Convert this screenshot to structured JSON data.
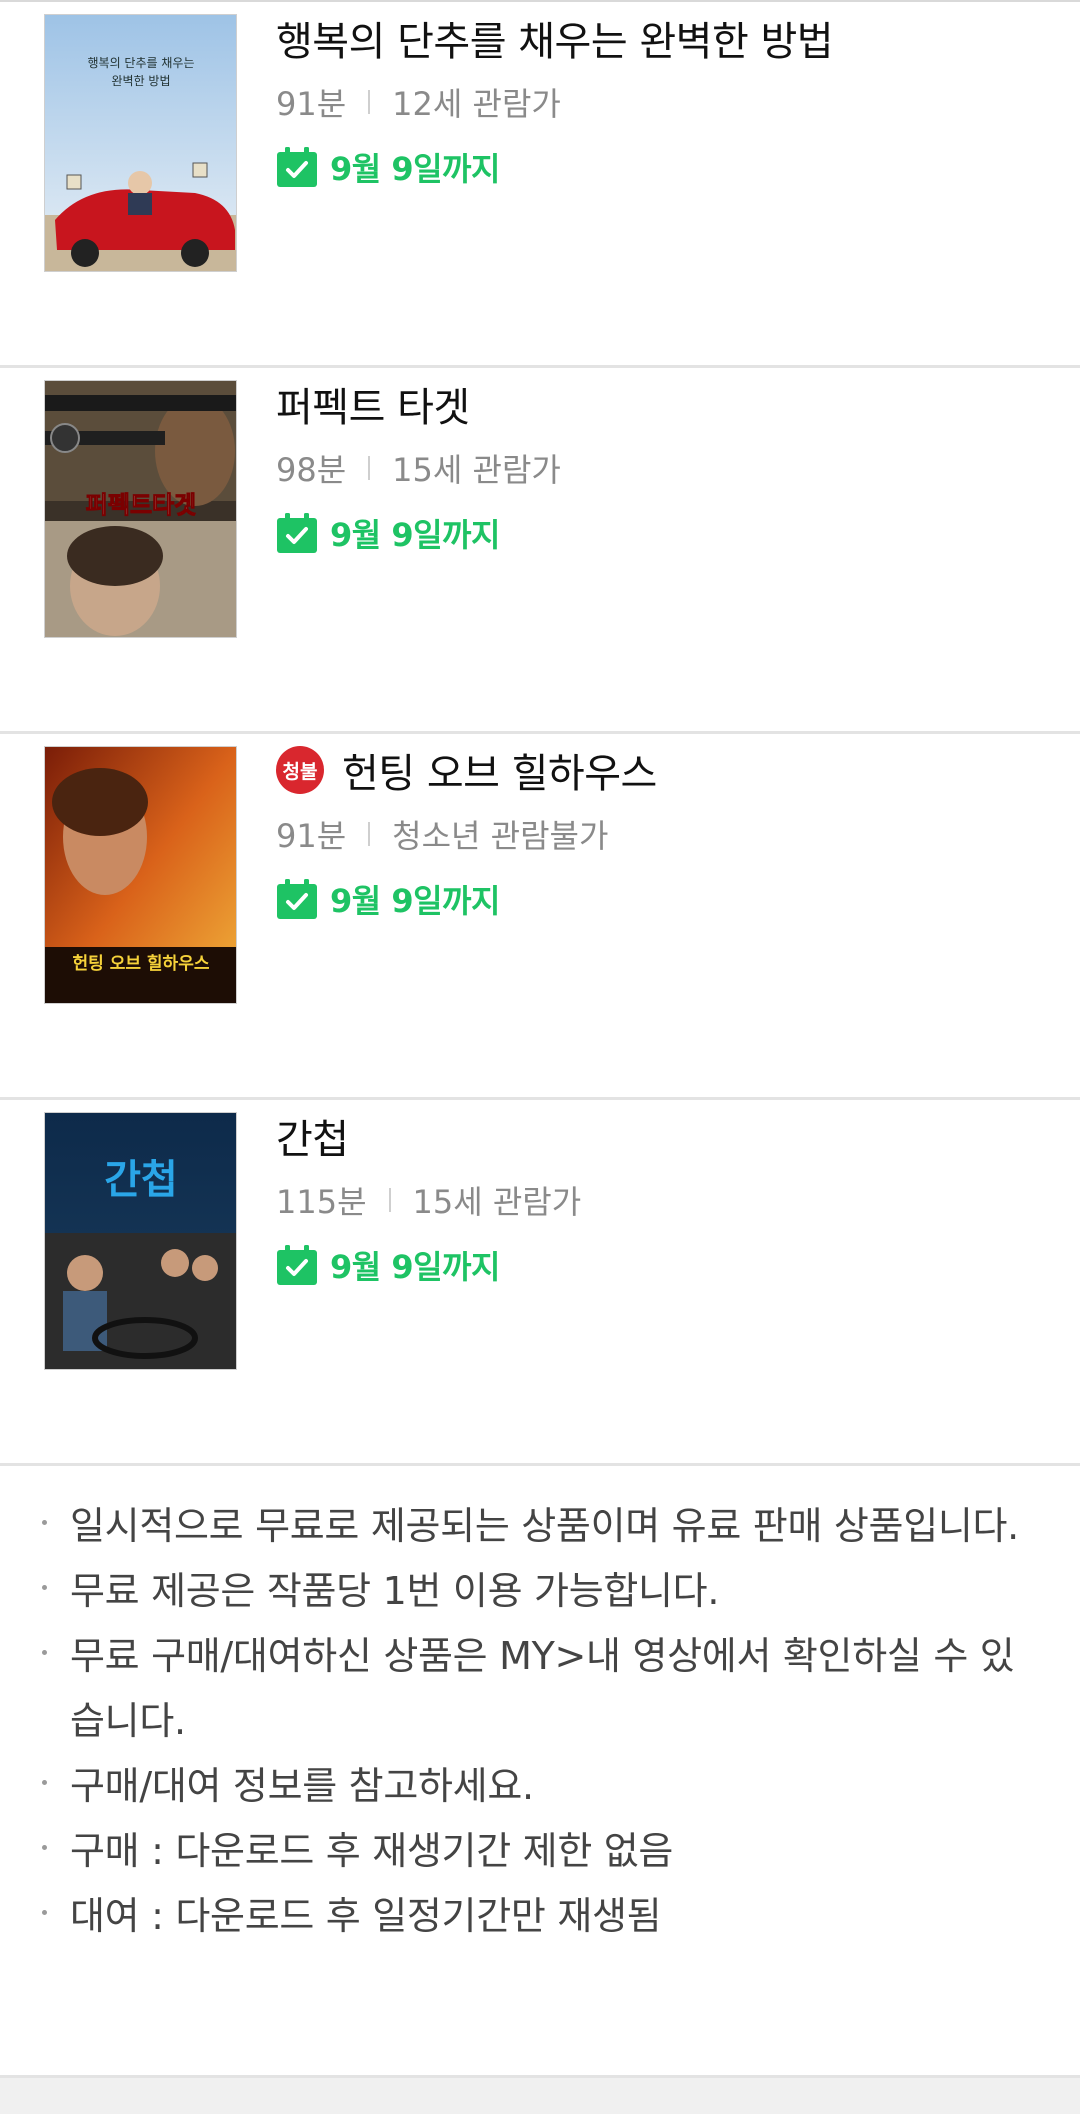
{
  "movies": [
    {
      "title": "행복의 단추를 채우는 완벽한 방법",
      "duration": "91분",
      "rating": "12세 관람가",
      "age_badge": "",
      "availability": "9월 9일까지",
      "poster": {
        "icon": "movie-poster",
        "text_lines": [
          "행복의 단추를 채우는",
          "완벽한 방법"
        ]
      }
    },
    {
      "title": "퍼펙트 타겟",
      "duration": "98분",
      "rating": "15세 관람가",
      "age_badge": "",
      "availability": "9월 9일까지",
      "poster": {
        "icon": "movie-poster",
        "text_lines": [
          "퍼펙트타겟"
        ]
      }
    },
    {
      "title": "헌팅 오브 힐하우스",
      "duration": "91분",
      "rating": "청소년 관람불가",
      "age_badge": "청불",
      "availability": "9월 9일까지",
      "poster": {
        "icon": "movie-poster",
        "text_lines": [
          "헌팅 오브 힐하우스"
        ]
      }
    },
    {
      "title": "간첩",
      "duration": "115분",
      "rating": "15세 관람가",
      "age_badge": "",
      "availability": "9월 9일까지",
      "poster": {
        "icon": "movie-poster",
        "text_lines": [
          "간첩"
        ]
      }
    }
  ],
  "notices": [
    "일시적으로 무료로 제공되는 상품이며 유료 판매 상품입니다.",
    "무료 제공은 작품당 1번 이용 가능합니다.",
    "무료 구매/대여하신 상품은 MY>내 영상에서 확인하실 수 있습니다.",
    "구매/대여 정보를 참고하세요.",
    "구매 : 다운로드 후 재생기간 제한 없음",
    "대여 : 다운로드 후 일정기간만 재생됨"
  ],
  "colors": {
    "accent_green": "#1ec364",
    "badge_red": "#d9272e",
    "meta_gray": "#8a8a8a"
  },
  "icons": {
    "availability": "calendar-check-icon",
    "bullet": "bullet-dot"
  }
}
